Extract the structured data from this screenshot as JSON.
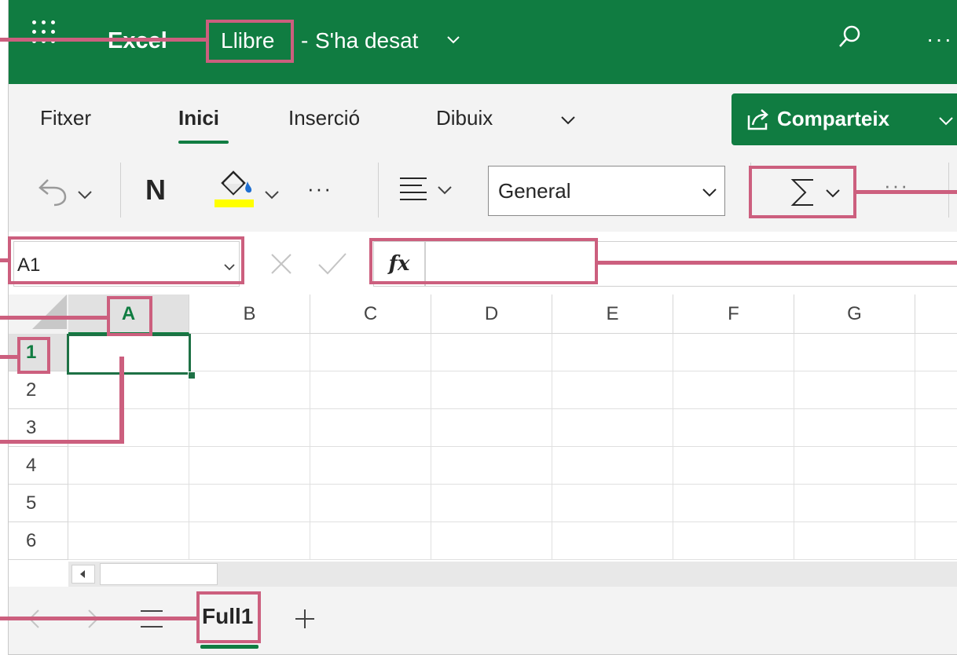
{
  "app": {
    "name": "Excel",
    "doc_name": "Llibre",
    "separator": "-",
    "save_state": "S'ha desat"
  },
  "tabs": [
    {
      "label": "Fitxer"
    },
    {
      "label": "Inici"
    },
    {
      "label": "Inserció"
    },
    {
      "label": "Dibuix"
    }
  ],
  "share": {
    "label": "Comparteix"
  },
  "toolbar": {
    "bold_label": "N",
    "more_label": "···",
    "more2_label": "···",
    "number_format": "General"
  },
  "formula_bar": {
    "name_box": "A1",
    "fx_label": "fx",
    "value": ""
  },
  "grid": {
    "columns": [
      "A",
      "B",
      "C",
      "D",
      "E",
      "F",
      "G"
    ],
    "rows": [
      "1",
      "2",
      "3",
      "4",
      "5",
      "6"
    ],
    "active_cell": "A1"
  },
  "sheets": [
    {
      "label": "Full1"
    }
  ],
  "colors": {
    "brand": "#107c41",
    "callout": "#cc5f7e",
    "fill_color": "#ffff00"
  }
}
